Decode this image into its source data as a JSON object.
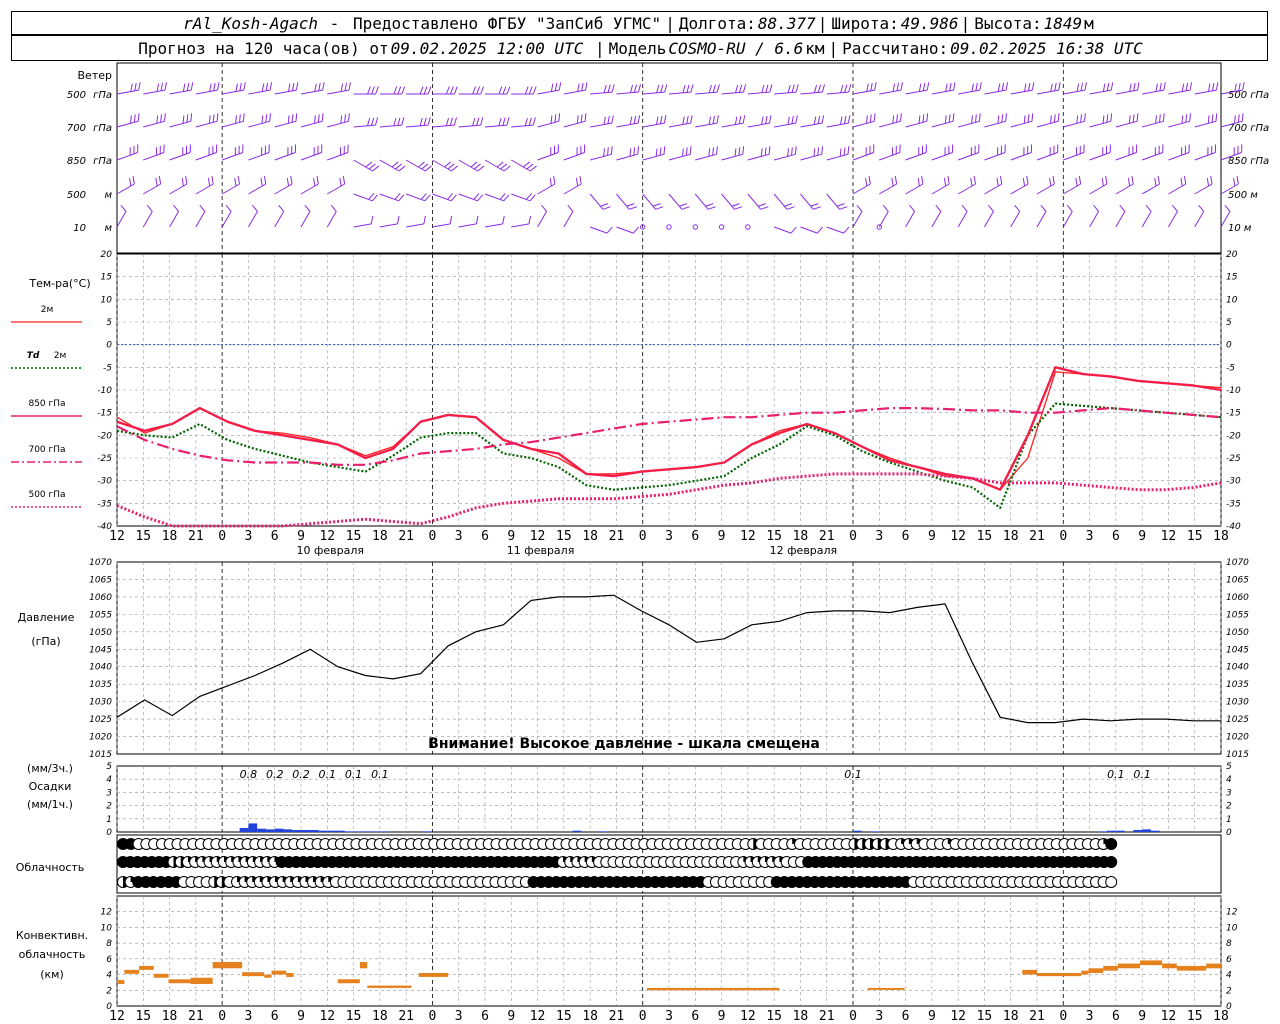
{
  "header": {
    "station": "rAl_Kosh-Agach",
    "provider": "Предоставлено ФГБУ \"ЗапСиб УГМС\"",
    "lon_label": "Долгота:",
    "lon_value": "88.377",
    "lat_label": "Широта:",
    "lat_value": "49.986",
    "alt_label": "Высота:",
    "alt_value": "1849",
    "alt_unit": "м",
    "forecast_label": "Прогноз на 120 часа(ов) от",
    "forecast_time": "09.02.2025 12:00 UTC",
    "model_label": "Модель",
    "model_name": "COSMO-RU / 6.6",
    "model_unit": "км",
    "calc_label": "Рассчитано:",
    "calc_time": "09.02.2025 16:38 UTC"
  },
  "colors": {
    "wind": "#8a2be2",
    "t2m": "#ff2020",
    "td2m": "#006400",
    "t850": "#e8206e",
    "t700": "#e8206e",
    "t500": "#e8206e",
    "zero": "#3050d0",
    "precip": "#2244dd",
    "conv": "#e6821e",
    "pressure": "#000000"
  },
  "chart_data": [
    {
      "id": "wind",
      "type": "wind-barbs",
      "title": "Ветер",
      "levels": [
        "500 гПа",
        "700 гПа",
        "850 гПа",
        "500 м",
        "10 м"
      ]
    },
    {
      "id": "temperature",
      "type": "line",
      "ylabel": "Тем-ра(°С)",
      "ylim": [
        -40,
        20
      ],
      "yticks": [
        20,
        15,
        10,
        5,
        0,
        -5,
        -10,
        -15,
        -20,
        -25,
        -30,
        -35,
        -40
      ],
      "x_hours": [
        0,
        3,
        6,
        9,
        12,
        15,
        18,
        21,
        24,
        27,
        30,
        33,
        36,
        39,
        42,
        45,
        48,
        51,
        54,
        57,
        60,
        63,
        66,
        69,
        72,
        75,
        78,
        81,
        84,
        87,
        90,
        93,
        96,
        99,
        102,
        105,
        108,
        111,
        114,
        117,
        120
      ],
      "series": [
        {
          "name": "2м",
          "style": "solid",
          "values": [
            -16,
            -19.5,
            -17.5,
            -14,
            -17,
            -19,
            -19.5,
            -20.5,
            -22,
            -24.5,
            -22.5,
            -17,
            -15.5,
            -16,
            -21,
            -23,
            -25,
            -28.5,
            -28.5,
            -28,
            -27.5,
            -27,
            -26,
            -22,
            -19,
            -17.5,
            -19.5,
            -22.5,
            -25,
            -27,
            -29,
            -29.5,
            -32,
            -25,
            -6,
            -6.5,
            -7,
            -8,
            -8.5,
            -9,
            -9.5
          ]
        },
        {
          "name": "Td 2м",
          "style": "dotted",
          "values": [
            -19,
            -20,
            -20.5,
            -17.5,
            -21,
            -23,
            -24.5,
            -26,
            -27,
            -28,
            -24.5,
            -20.5,
            -19.5,
            -19.5,
            -24,
            -25,
            -27,
            -31,
            -32,
            -31.5,
            -31,
            -30,
            -29,
            -25,
            -22,
            -18,
            -20,
            -23.5,
            -26,
            -28,
            -30,
            -31.5,
            -36,
            -20,
            -13,
            -13.5,
            -14,
            -14.5,
            -15,
            -15.5,
            -16
          ]
        },
        {
          "name": "850 гПа",
          "style": "solid-thick",
          "values": [
            -17,
            -19,
            -17.5,
            -14,
            -17,
            -19,
            -20,
            -21,
            -22,
            -25,
            -23,
            -17,
            -15.5,
            -16,
            -21,
            -23,
            -24,
            -28.5,
            -29,
            -28,
            -27.5,
            -27,
            -26,
            -22,
            -19.5,
            -17.5,
            -19.5,
            -22.5,
            -25.5,
            -27,
            -28.5,
            -29.5,
            -32,
            -20,
            -5,
            -6.5,
            -7,
            -8,
            -8.5,
            -9,
            -10
          ]
        },
        {
          "name": "700 гПа",
          "style": "dashdot",
          "values": [
            -18,
            -21,
            -23,
            -24.5,
            -25.5,
            -26,
            -26,
            -26,
            -26.5,
            -26.5,
            -25.5,
            -24,
            -23.5,
            -23,
            -22,
            -21.5,
            -20.5,
            -19.5,
            -18.5,
            -17.5,
            -17,
            -16.5,
            -16,
            -16,
            -15.5,
            -15,
            -15,
            -14.5,
            -14,
            -14,
            -14.2,
            -14.5,
            -14.5,
            -15,
            -15,
            -14.5,
            -14,
            -14.5,
            -15,
            -15.5,
            -16
          ]
        },
        {
          "name": "500 гПа",
          "style": "dotted",
          "values": [
            -35.5,
            -38,
            -40,
            -42,
            -42,
            -41,
            -40,
            -39.5,
            -39,
            -38.5,
            -39,
            -39.5,
            -38,
            -36,
            -35,
            -34.5,
            -34,
            -34,
            -34,
            -33.5,
            -33,
            -32,
            -31,
            -30.5,
            -29.5,
            -29,
            -28.5,
            -28.5,
            -28.5,
            -28.5,
            -29,
            -29.5,
            -30.5,
            -30.5,
            -30.5,
            -31,
            -31.5,
            -32,
            -32,
            -31.5,
            -30.5
          ]
        }
      ],
      "zero_line": 0
    },
    {
      "id": "pressure",
      "type": "line",
      "ylabel": "Давление",
      "yunit": "(гПа)",
      "ylim": [
        1015,
        1070
      ],
      "yticks": [
        1070,
        1065,
        1060,
        1055,
        1050,
        1045,
        1040,
        1035,
        1030,
        1025,
        1020,
        1015
      ],
      "x_hours": [
        0,
        3,
        6,
        9,
        12,
        15,
        18,
        21,
        24,
        27,
        30,
        33,
        36,
        39,
        42,
        45,
        48,
        51,
        54,
        57,
        60,
        63,
        66,
        69,
        72,
        75,
        78,
        81,
        84,
        87,
        90,
        93,
        96,
        99,
        102,
        105,
        108,
        111,
        114,
        117,
        120
      ],
      "values": [
        1025.5,
        1030.5,
        1026,
        1031.5,
        1034.5,
        1037.5,
        1041,
        1045,
        1040,
        1037.5,
        1036.5,
        1038,
        1046,
        1050,
        1052,
        1059,
        1060,
        1060,
        1060.5,
        1056,
        1052,
        1047,
        1048,
        1052,
        1053,
        1055.5,
        1056,
        1056,
        1055.5,
        1057,
        1058,
        1041,
        1025.5,
        1024,
        1024,
        1025,
        1024.5,
        1025,
        1025,
        1024.5,
        1024.5
      ],
      "notice": "Внимание! Высокое давление - шкала смещена"
    },
    {
      "id": "precipitation",
      "type": "bar",
      "ylabel_top": "(мм/3ч.)",
      "ylabel_mid": "Осадки",
      "ylabel_bot": "(мм/1ч.)",
      "ylim": [
        0,
        5
      ],
      "yticks": [
        5,
        4,
        3,
        2,
        1,
        0
      ],
      "labels": [
        {
          "hour": 15,
          "text": "0.8"
        },
        {
          "hour": 18,
          "text": "0.2"
        },
        {
          "hour": 21,
          "text": "0.2"
        },
        {
          "hour": 24,
          "text": "0.1"
        },
        {
          "hour": 27,
          "text": "0.1"
        },
        {
          "hour": 30,
          "text": "0.1"
        },
        {
          "hour": 84,
          "text": "0.1"
        },
        {
          "hour": 114,
          "text": "0.1"
        },
        {
          "hour": 117,
          "text": "0.1"
        }
      ],
      "bars_hourly": [
        {
          "hour": 14,
          "value": 0.3
        },
        {
          "hour": 15,
          "value": 0.65
        },
        {
          "hour": 16,
          "value": 0.25
        },
        {
          "hour": 17,
          "value": 0.2
        },
        {
          "hour": 18,
          "value": 0.25
        },
        {
          "hour": 19,
          "value": 0.2
        },
        {
          "hour": 20,
          "value": 0.15
        },
        {
          "hour": 21,
          "value": 0.15
        },
        {
          "hour": 22,
          "value": 0.15
        },
        {
          "hour": 23,
          "value": 0.1
        },
        {
          "hour": 24,
          "value": 0.1
        },
        {
          "hour": 25,
          "value": 0.1
        },
        {
          "hour": 26,
          "value": 0.05
        },
        {
          "hour": 27,
          "value": 0.05
        },
        {
          "hour": 28,
          "value": 0.05
        },
        {
          "hour": 29,
          "value": 0.05
        },
        {
          "hour": 30,
          "value": 0.05
        },
        {
          "hour": 35,
          "value": 0.05
        },
        {
          "hour": 52,
          "value": 0.1
        },
        {
          "hour": 55,
          "value": 0.05
        },
        {
          "hour": 84,
          "value": 0.1
        },
        {
          "hour": 86,
          "value": 0.05
        },
        {
          "hour": 112,
          "value": 0.05
        },
        {
          "hour": 113,
          "value": 0.1
        },
        {
          "hour": 114,
          "value": 0.1
        },
        {
          "hour": 116,
          "value": 0.15
        },
        {
          "hour": 117,
          "value": 0.2
        },
        {
          "hour": 118,
          "value": 0.1
        }
      ]
    },
    {
      "id": "cloudiness",
      "type": "symbol-grid",
      "ylabel": "Облачность",
      "rows": [
        "FFOOOOOOOOOOOOOOOOOOOOOOOOOOOOOOOOOOOOOOOOOOOOOOOOOOOOOOOOOOOOOOOOOOOOOOOOOOOOOOOHOOOOQOOOOOOOHHHHHOQQQOOOQOOOOOOOOOOOOOOOOOOOQF",
        "FFFFFFFHHQQQQQQQQQQQQQFFFFFFFFFFFFFFFFFFFFFFFFFFFFFFFFFFFFFFFQQQQQOOOOOOOOOOOOOOOOOOOOQQQQQQOOOFFFFFFFFFFFFFFFFFFFFFFFFFFFFFFFFFFFFFFFFFFF",
        "HQFFFFFFOOOOHHOQQQQQQQQQQQQQOOOOOOOOOOOOOOOOOOOOOOOOOOFFFFFFFFFFFFFFFFFFFFFFFOOOOOOOOOFFFFFFFFFFFFFFFFFFOOOOOOOOOOOOOOOOOOOOOOOOOOO"
      ]
    },
    {
      "id": "convective",
      "type": "bar",
      "ylabel_1": "Конвективн.",
      "ylabel_2": "облачность",
      "ylabel_3": "(км)",
      "ylim": [
        0,
        14
      ],
      "yticks": [
        12,
        10,
        8,
        6,
        4,
        2,
        0
      ],
      "segments": [
        {
          "h0": 0,
          "h1": 1,
          "bottom": 2.8,
          "top": 3.3
        },
        {
          "h0": 1,
          "h1": 3,
          "bottom": 4.1,
          "top": 4.6
        },
        {
          "h0": 3,
          "h1": 5,
          "bottom": 4.6,
          "top": 5.1
        },
        {
          "h0": 5,
          "h1": 7,
          "bottom": 3.6,
          "top": 4.1
        },
        {
          "h0": 7,
          "h1": 10,
          "bottom": 2.9,
          "top": 3.4
        },
        {
          "h0": 10,
          "h1": 13,
          "bottom": 2.8,
          "top": 3.6
        },
        {
          "h0": 13,
          "h1": 17,
          "bottom": 4.8,
          "top": 5.6
        },
        {
          "h0": 17,
          "h1": 20,
          "bottom": 3.8,
          "top": 4.3
        },
        {
          "h0": 20,
          "h1": 21,
          "bottom": 3.6,
          "top": 4.0
        },
        {
          "h0": 21,
          "h1": 23,
          "bottom": 4.0,
          "top": 4.5
        },
        {
          "h0": 23,
          "h1": 24,
          "bottom": 3.7,
          "top": 4.2
        },
        {
          "h0": 30,
          "h1": 33,
          "bottom": 2.9,
          "top": 3.4
        },
        {
          "h0": 33,
          "h1": 34,
          "bottom": 4.8,
          "top": 5.6
        },
        {
          "h0": 34,
          "h1": 40,
          "bottom": 2.3,
          "top": 2.6
        },
        {
          "h0": 41,
          "h1": 45,
          "bottom": 3.7,
          "top": 4.2
        },
        {
          "h0": 72,
          "h1": 90,
          "bottom": 2.0,
          "top": 2.3
        },
        {
          "h0": 102,
          "h1": 107,
          "bottom": 2.1,
          "top": 2.3
        },
        {
          "h0": 123,
          "h1": 125,
          "bottom": 4.0,
          "top": 4.6
        },
        {
          "h0": 125,
          "h1": 131,
          "bottom": 3.8,
          "top": 4.2
        },
        {
          "h0": 131,
          "h1": 132,
          "bottom": 4.0,
          "top": 4.5
        },
        {
          "h0": 132,
          "h1": 134,
          "bottom": 4.2,
          "top": 4.8
        },
        {
          "h0": 134,
          "h1": 136,
          "bottom": 4.5,
          "top": 5.1
        },
        {
          "h0": 136,
          "h1": 139,
          "bottom": 4.8,
          "top": 5.4
        },
        {
          "h0": 139,
          "h1": 142,
          "bottom": 5.2,
          "top": 5.8
        },
        {
          "h0": 142,
          "h1": 144,
          "bottom": 4.8,
          "top": 5.4
        },
        {
          "h0": 144,
          "h1": 148,
          "bottom": 4.5,
          "top": 5.1
        },
        {
          "h0": 148,
          "h1": 150,
          "bottom": 4.8,
          "top": 5.4
        }
      ]
    }
  ],
  "time_axis": {
    "start_hour": 12,
    "step_hours": 3,
    "tick_labels": [
      "12",
      "15",
      "18",
      "21",
      "0",
      "3",
      "6",
      "9",
      "12",
      "15",
      "18",
      "21",
      "0",
      "3",
      "6",
      "9",
      "12",
      "15",
      "18",
      "21",
      "0",
      "3",
      "6",
      "9",
      "12",
      "15",
      "18",
      "21",
      "0",
      "3",
      "6",
      "9",
      "12",
      "15",
      "18",
      "21",
      "0",
      "3",
      "6",
      "9",
      "12",
      "15",
      "18"
    ],
    "dates": [
      {
        "hour_index": 8,
        "text": "10 февраля"
      },
      {
        "hour_index": 16,
        "text": "11 февраля"
      },
      {
        "hour_index": 26,
        "text": "12 февраля"
      }
    ]
  },
  "legend": {
    "t2m": "2м",
    "td_symbol": "Td",
    "td": "2м",
    "p850": "850 гПа",
    "p700": "700 гПа",
    "p500": "500 гПа"
  }
}
